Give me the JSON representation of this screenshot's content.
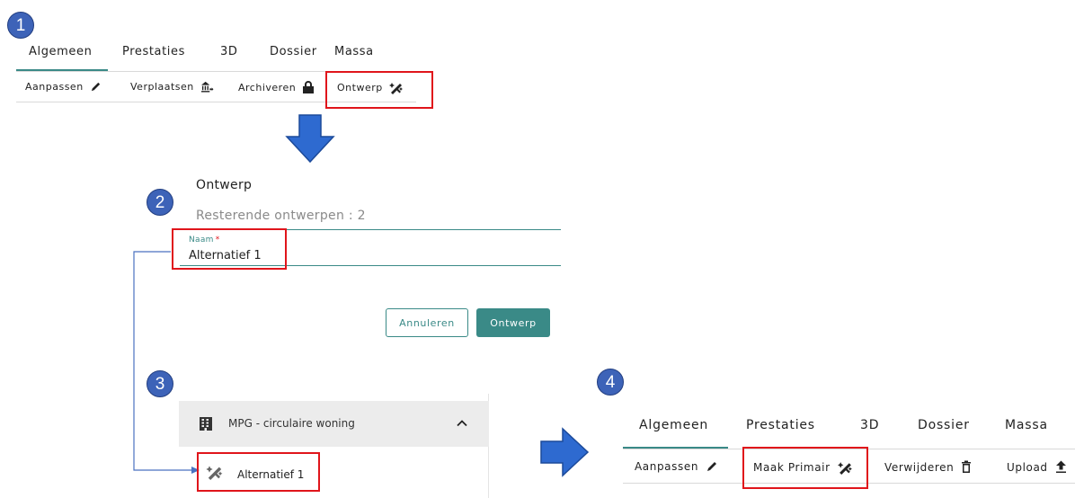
{
  "steps": [
    "1",
    "2",
    "3",
    "4"
  ],
  "toolbar1": {
    "tabs": [
      "Algemeen",
      "Prestaties",
      "3D",
      "Dossier",
      "Massa"
    ],
    "active_tab": "Algemeen",
    "actions": [
      {
        "label": "Aanpassen",
        "icon": "pencil-icon"
      },
      {
        "label": "Verplaatsen",
        "icon": "move-building-icon"
      },
      {
        "label": "Archiveren",
        "icon": "lock-icon"
      },
      {
        "label": "Ontwerp",
        "icon": "design-tools-icon"
      }
    ]
  },
  "dialog": {
    "title": "Ontwerp",
    "remaining": "Resterende ontwerpen : 2",
    "name_label": "Naam",
    "required_mark": "*",
    "name_value": "Alternatief 1",
    "cancel_label": "Annuleren",
    "submit_label": "Ontwerp"
  },
  "tree": {
    "project_label": "MPG - circulaire woning",
    "project_icon": "building-icon",
    "collapse_icon": "chevron-up-icon",
    "child_label": "Alternatief 1",
    "child_icon": "design-tools-icon"
  },
  "toolbar2": {
    "tabs": [
      "Algemeen",
      "Prestaties",
      "3D",
      "Dossier",
      "Massa"
    ],
    "active_tab": "Algemeen",
    "actions": [
      {
        "label": "Aanpassen",
        "icon": "pencil-icon"
      },
      {
        "label": "Maak Primair",
        "icon": "design-tools-icon"
      },
      {
        "label": "Verwijderen",
        "icon": "trash-icon"
      },
      {
        "label": "Upload",
        "icon": "upload-icon"
      }
    ]
  },
  "colors": {
    "accent": "#3a8a87",
    "highlight": "#e0151b",
    "step_badge": "#3d63b8",
    "arrow": "#2e6ad0"
  }
}
